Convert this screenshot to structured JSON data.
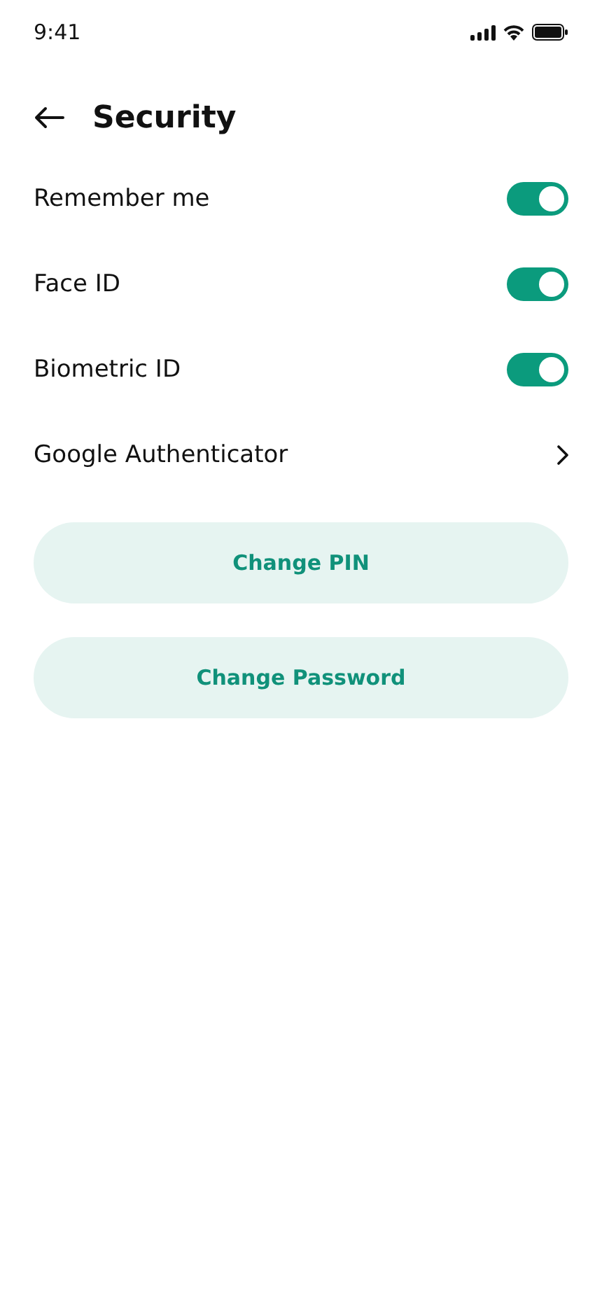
{
  "status_bar": {
    "time": "9:41"
  },
  "header": {
    "title": "Security"
  },
  "settings": [
    {
      "kind": "toggle",
      "label": "Remember me",
      "on": true
    },
    {
      "kind": "toggle",
      "label": "Face ID",
      "on": true
    },
    {
      "kind": "toggle",
      "label": "Biometric ID",
      "on": true
    },
    {
      "kind": "link",
      "label": "Google Authenticator"
    }
  ],
  "buttons": [
    "Change PIN",
    "Change Password"
  ]
}
